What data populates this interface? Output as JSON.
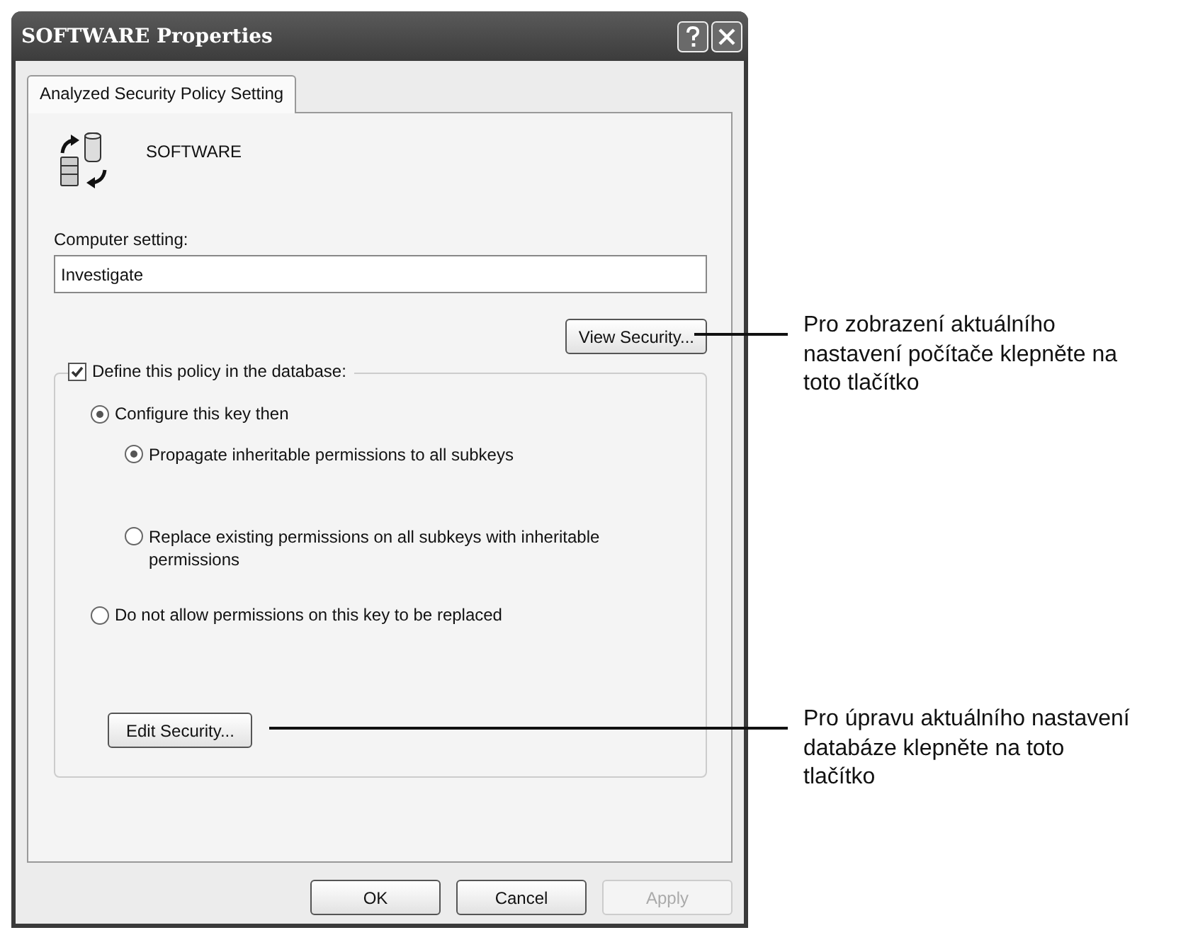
{
  "window": {
    "title": "SOFTWARE Properties"
  },
  "tabs": [
    {
      "label": "Analyzed Security Policy Setting",
      "selected": true
    }
  ],
  "object": {
    "name": "SOFTWARE"
  },
  "computer_setting": {
    "label": "Computer setting:",
    "value": "Investigate"
  },
  "view_button": "View Security...",
  "define_policy": {
    "label": "Define this policy in the database:",
    "checked": true
  },
  "options": [
    {
      "label": "Configure this key then",
      "selected": true,
      "children": [
        {
          "label": "Propagate inheritable permissions to all subkeys",
          "selected": true
        },
        {
          "label": "Replace existing permissions on all subkeys with inheritable permissions",
          "selected": false
        }
      ]
    },
    {
      "label": "Do not allow permissions on this key to be replaced",
      "selected": false
    }
  ],
  "edit_button": "Edit Security...",
  "buttons": [
    {
      "label": "OK",
      "disabled": false
    },
    {
      "label": "Cancel",
      "disabled": false
    },
    {
      "label": "Apply",
      "disabled": true
    }
  ],
  "callouts": [
    "Pro zobrazení aktuálního nastavení počítače klepněte na toto tlačítko",
    "Pro úpravu aktuálního nastavení databáze klepněte na toto tlačítko"
  ]
}
